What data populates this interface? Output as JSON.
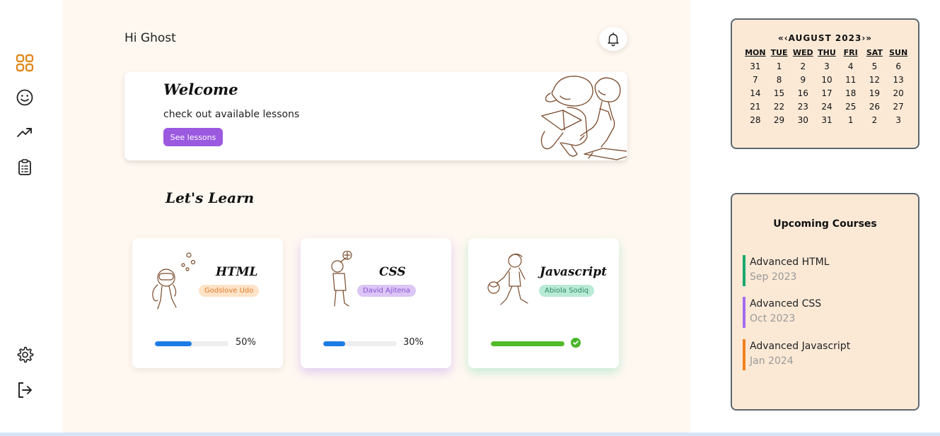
{
  "greeting": "Hi Ghost",
  "sidebar": {
    "items": [
      {
        "icon": "grid-icon",
        "label": "Dashboard",
        "active": true
      },
      {
        "icon": "smiley-icon",
        "label": "Profile"
      },
      {
        "icon": "trending-up-icon",
        "label": "Progress"
      },
      {
        "icon": "clipboard-icon",
        "label": "Tasks"
      }
    ],
    "bottom": [
      {
        "icon": "gear-icon",
        "label": "Settings"
      },
      {
        "icon": "logout-icon",
        "label": "Logout"
      }
    ]
  },
  "welcome": {
    "title": "Welcome",
    "subtitle": "check out available lessons",
    "button": "See lessons"
  },
  "learn": {
    "title": "Let's Learn",
    "courses": [
      {
        "name": "HTML",
        "tutor": "Godslove Udo",
        "progress": 50,
        "progress_label": "50%",
        "completed": false
      },
      {
        "name": "CSS",
        "tutor": "David Ajitena",
        "progress": 30,
        "progress_label": "30%",
        "completed": false
      },
      {
        "name": "Javascript",
        "tutor": "Abiola Sodiq",
        "progress": 100,
        "progress_label": "",
        "completed": true
      }
    ]
  },
  "calendar": {
    "header": "«‹AUGUST 2023›»",
    "weekdays": [
      "MON",
      "TUE",
      "WED",
      "THU",
      "FRI",
      "SAT",
      "SUN"
    ],
    "days": [
      "31",
      "1",
      "2",
      "3",
      "4",
      "5",
      "6",
      "7",
      "8",
      "9",
      "10",
      "11",
      "12",
      "13",
      "14",
      "15",
      "16",
      "17",
      "18",
      "19",
      "20",
      "21",
      "22",
      "23",
      "24",
      "25",
      "26",
      "27",
      "28",
      "29",
      "30",
      "31",
      "1",
      "2",
      "3"
    ]
  },
  "upcoming": {
    "title": "Upcoming Courses",
    "items": [
      {
        "name": "Advanced HTML",
        "date": "Sep 2023",
        "color": "#1aa86e"
      },
      {
        "name": "Advanced CSS",
        "date": "Oct 2023",
        "color": "#a46cf0"
      },
      {
        "name": "Advanced Javascript",
        "date": "Jan 2024",
        "color": "#f0821e"
      }
    ]
  },
  "colors": {
    "accent": "#e08a1e",
    "button": "#9b59e0",
    "main_bg": "#fff8f1",
    "panel_bg": "#fbe9d6",
    "html_badge_bg": "#fde3c8",
    "html_badge_fg": "#e07a2a",
    "css_badge_bg": "#dcc6f5",
    "css_badge_fg": "#8a50d8",
    "js_badge_bg": "#b9ead6",
    "js_badge_fg": "#2e8a66",
    "html_bar": "#1c7ce6",
    "css_bar": "#1c7ce6",
    "js_bar": "#52bb2a"
  }
}
